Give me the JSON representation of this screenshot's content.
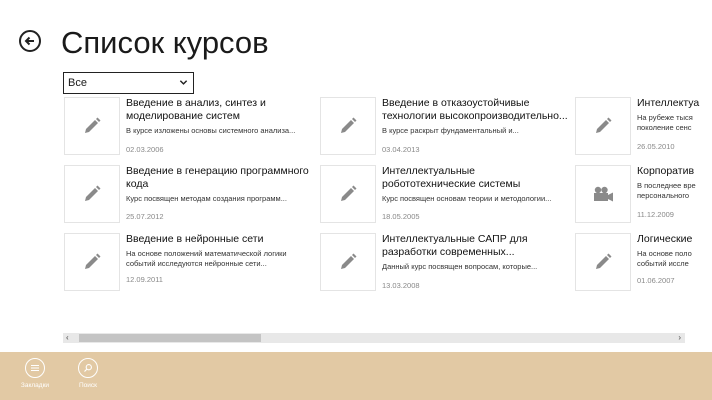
{
  "page": {
    "title": "Список курсов"
  },
  "filter": {
    "selected": "Все"
  },
  "courses": [
    {
      "title": "Введение в анализ, синтез и моделирование систем",
      "desc": "В курсе изложены основы системного анализа...",
      "date": "02.03.2006",
      "icon": "pencil-icon"
    },
    {
      "title": "Введение в генерацию программного кода",
      "desc": "Курс посвящен методам создания программ...",
      "date": "25.07.2012",
      "icon": "pencil-icon"
    },
    {
      "title": "Введение в нейронные сети",
      "desc": "На основе положений математической логики событий исследуются нейронные сети...",
      "date": "12.09.2011",
      "icon": "pencil-icon"
    },
    {
      "title": "Введение в отказоустойчивые технологии высокопроизводительно...",
      "desc": "В курсе раскрыт фундаментальный и...",
      "date": "03.04.2013",
      "icon": "pencil-icon"
    },
    {
      "title": "Интеллектуальные робототехнические системы",
      "desc": "Курс посвящен основам теории и методологии...",
      "date": "18.05.2005",
      "icon": "pencil-icon"
    },
    {
      "title": "Интеллектуальные САПР для разработки современных...",
      "desc": "Данный курс посвящен вопросам, которые...",
      "date": "13.03.2008",
      "icon": "pencil-icon"
    },
    {
      "title": "Интеллектуа",
      "desc": "На рубеже тыся",
      "desc2": "поколение сенс",
      "date": "26.05.2010",
      "icon": "pencil-icon"
    },
    {
      "title": "Корпоратив",
      "desc": "В последнее вре",
      "desc2": "персонального",
      "date": "11.12.2009",
      "icon": "video-camera-icon"
    },
    {
      "title": "Логические",
      "desc": "На основе поло",
      "desc2": "событий иссле",
      "date": "01.06.2007",
      "icon": "pencil-icon"
    }
  ],
  "appbar": {
    "bookmarks_label": "Закладки",
    "search_label": "Поиск"
  },
  "colors": {
    "appbar": "#e2c9a4",
    "tile_border": "#e4e4e4",
    "icon": "#8a8a8a"
  }
}
